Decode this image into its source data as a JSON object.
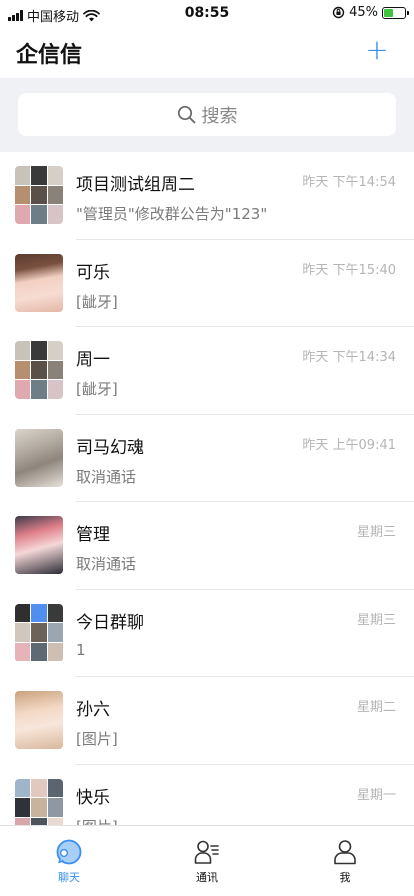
{
  "status_bar": {
    "carrier": "中国移动",
    "time": "08:55",
    "battery": "45%",
    "battery_level": 0.45
  },
  "header": {
    "title": "企信信",
    "add_label": "+"
  },
  "search": {
    "placeholder": "搜索"
  },
  "chats": [
    {
      "name": "项目测试组周二",
      "preview": "\"管理员\"修改群公告为\"123\"",
      "time": "昨天 下午14:54"
    },
    {
      "name": "可乐",
      "preview": "[龇牙]",
      "time": "昨天 下午15:40"
    },
    {
      "name": "周一",
      "preview": "[龇牙]",
      "time": "昨天 下午14:34"
    },
    {
      "name": "司马幻魂",
      "preview": "取消通话",
      "time": "昨天 上午09:41"
    },
    {
      "name": "管理",
      "preview": "取消通话",
      "time": "星期三"
    },
    {
      "name": "今日群聊",
      "preview": "1",
      "time": "星期三"
    },
    {
      "name": "孙六",
      "preview": "[图片]",
      "time": "星期二"
    },
    {
      "name": "快乐",
      "preview": "[图片]",
      "time": "星期一"
    }
  ],
  "tabs": [
    {
      "label": "聊天",
      "icon": "chat-icon",
      "active": true
    },
    {
      "label": "通讯",
      "icon": "contacts-icon",
      "active": false
    },
    {
      "label": "我",
      "icon": "profile-icon",
      "active": false
    }
  ],
  "colors": {
    "accent": "#3a8ff2",
    "battery_green": "#3ec43e"
  }
}
